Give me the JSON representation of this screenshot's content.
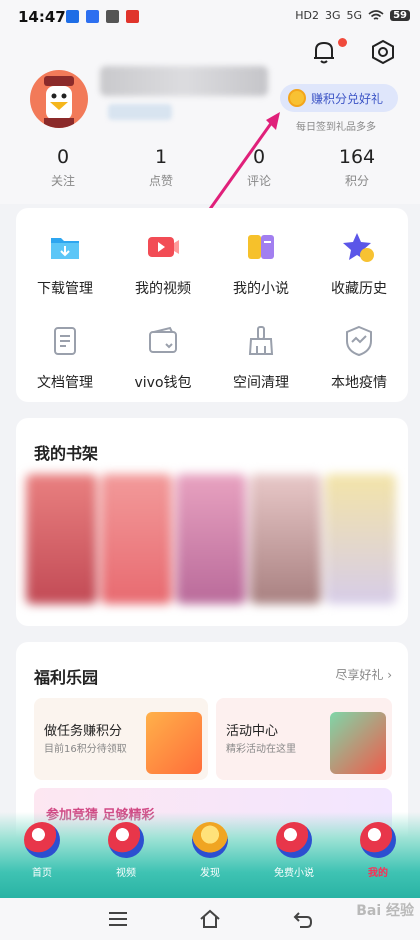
{
  "status_bar": {
    "time": "14:47",
    "network_labels": [
      "HD2",
      "3G",
      "5G"
    ],
    "battery": "59"
  },
  "header": {
    "redeem_button": "赚积分兑好礼",
    "redeem_hint": "每日签到礼品多多"
  },
  "stats": [
    {
      "value": "0",
      "label": "关注"
    },
    {
      "value": "1",
      "label": "点赞"
    },
    {
      "value": "0",
      "label": "评论"
    },
    {
      "value": "164",
      "label": "积分"
    }
  ],
  "grid_items": [
    {
      "label": "下载管理",
      "icon": "download-folder-icon"
    },
    {
      "label": "我的视频",
      "icon": "video-play-icon"
    },
    {
      "label": "我的小说",
      "icon": "book-icon"
    },
    {
      "label": "收藏历史",
      "icon": "star-icon"
    },
    {
      "label": "文档管理",
      "icon": "document-icon"
    },
    {
      "label": "vivo钱包",
      "icon": "wallet-icon"
    },
    {
      "label": "空间清理",
      "icon": "broom-icon"
    },
    {
      "label": "本地疫情",
      "icon": "shield-icon"
    }
  ],
  "shelf": {
    "title": "我的书架"
  },
  "welfare": {
    "title": "福利乐园",
    "more": "尽享好礼",
    "task_title": "做任务赚积分",
    "task_sub": "目前16积分待领取",
    "activity_title": "活动中心",
    "activity_sub": "精彩活动在这里",
    "banner": "参加竞猜 足够精彩"
  },
  "tabs": [
    {
      "label": "首页",
      "active": false
    },
    {
      "label": "视频",
      "active": false
    },
    {
      "label": "发现",
      "active": false
    },
    {
      "label": "免费小说",
      "active": false
    },
    {
      "label": "我的",
      "active": true
    }
  ],
  "watermark": "Bai 经验",
  "colors": {
    "accent": "#ff2d55",
    "redeem_text": "#3d55c6"
  }
}
